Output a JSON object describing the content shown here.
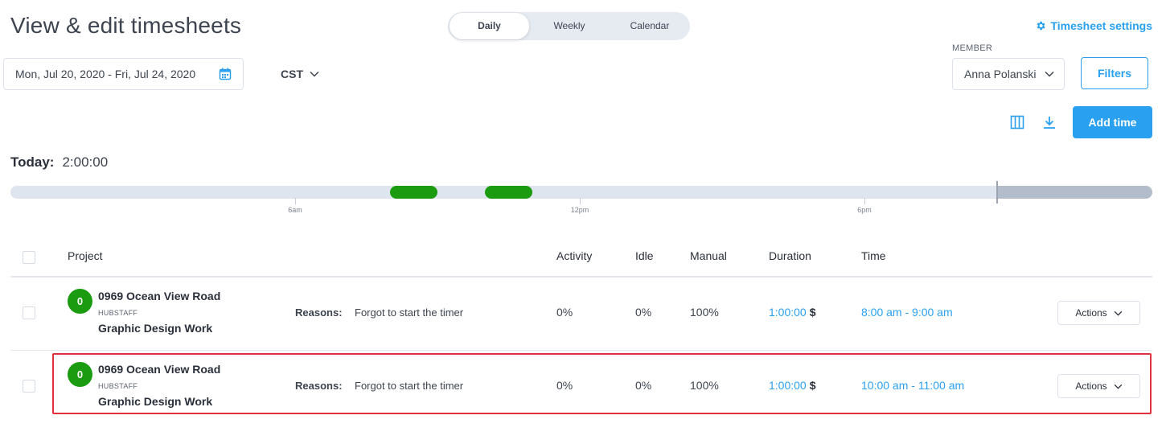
{
  "header": {
    "title": "View & edit timesheets",
    "view_tabs": [
      {
        "label": "Daily",
        "active": true
      },
      {
        "label": "Weekly",
        "active": false
      },
      {
        "label": "Calendar",
        "active": false
      }
    ],
    "settings_link": "Timesheet settings"
  },
  "filters": {
    "date_range": "Mon, Jul 20, 2020 - Fri, Jul 24, 2020",
    "timezone": "CST",
    "member_label": "MEMBER",
    "member_value": "Anna Polanski",
    "filters_button": "Filters",
    "add_time_button": "Add time"
  },
  "summary": {
    "today_label": "Today:",
    "today_value": "2:00:00"
  },
  "timeline": {
    "tick_labels": [
      "6am",
      "12pm",
      "6pm"
    ],
    "entries": [
      {
        "start": "8:00 am",
        "end": "9:00 am"
      },
      {
        "start": "10:00 am",
        "end": "11:00 am"
      }
    ],
    "colors": {
      "entry": "#1a9b10",
      "track": "#dfe5ee",
      "future": "#b3bccb"
    }
  },
  "table": {
    "columns": [
      "Project",
      "Activity",
      "Idle",
      "Manual",
      "Duration",
      "Time"
    ],
    "rows": [
      {
        "avatar": "0",
        "project": "0969 Ocean View Road",
        "organization": "HUBSTAFF",
        "task": "Graphic Design Work",
        "reasons_label": "Reasons:",
        "reasons": "Forgot to start the timer",
        "activity": "0%",
        "idle": "0%",
        "manual": "100%",
        "duration": "1:00:00",
        "billable": "$",
        "time": "8:00 am - 9:00 am",
        "actions": "Actions"
      },
      {
        "avatar": "0",
        "project": "0969 Ocean View Road",
        "organization": "HUBSTAFF",
        "task": "Graphic Design Work",
        "reasons_label": "Reasons:",
        "reasons": "Forgot to start the timer",
        "activity": "0%",
        "idle": "0%",
        "manual": "100%",
        "duration": "1:00:00",
        "billable": "$",
        "time": "10:00 am - 11:00 am",
        "actions": "Actions"
      }
    ]
  },
  "colors": {
    "accent": "#2aa0f0",
    "highlight": "#e0323e"
  }
}
